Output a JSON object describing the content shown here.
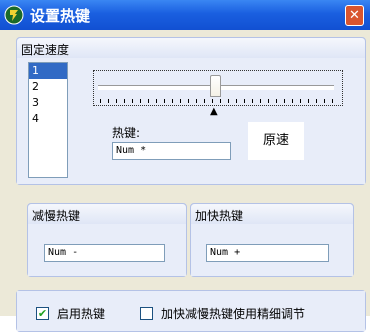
{
  "window": {
    "title": "设置热键",
    "close_glyph": "✕"
  },
  "fixed_speed": {
    "title": "固定速度",
    "list_items": [
      "1",
      "2",
      "3",
      "4"
    ],
    "selected_index": 0,
    "slider_level": 0.5,
    "hotkey_label": "热键:",
    "hotkey_value": "Num *",
    "speed_label": "原速"
  },
  "slow_group": {
    "title": "减慢热键",
    "value": "Num -"
  },
  "fast_group": {
    "title": "加快热键",
    "value": "Num +"
  },
  "options": {
    "enable_hotkey": {
      "label": "启用热键",
      "checked": true
    },
    "fine_tune": {
      "label": "加快减慢热键使用精细调节",
      "checked": false
    }
  },
  "icons": {
    "app": "app-logo-icon",
    "close": "close-icon",
    "pointer": "pointer-triangle-icon"
  }
}
